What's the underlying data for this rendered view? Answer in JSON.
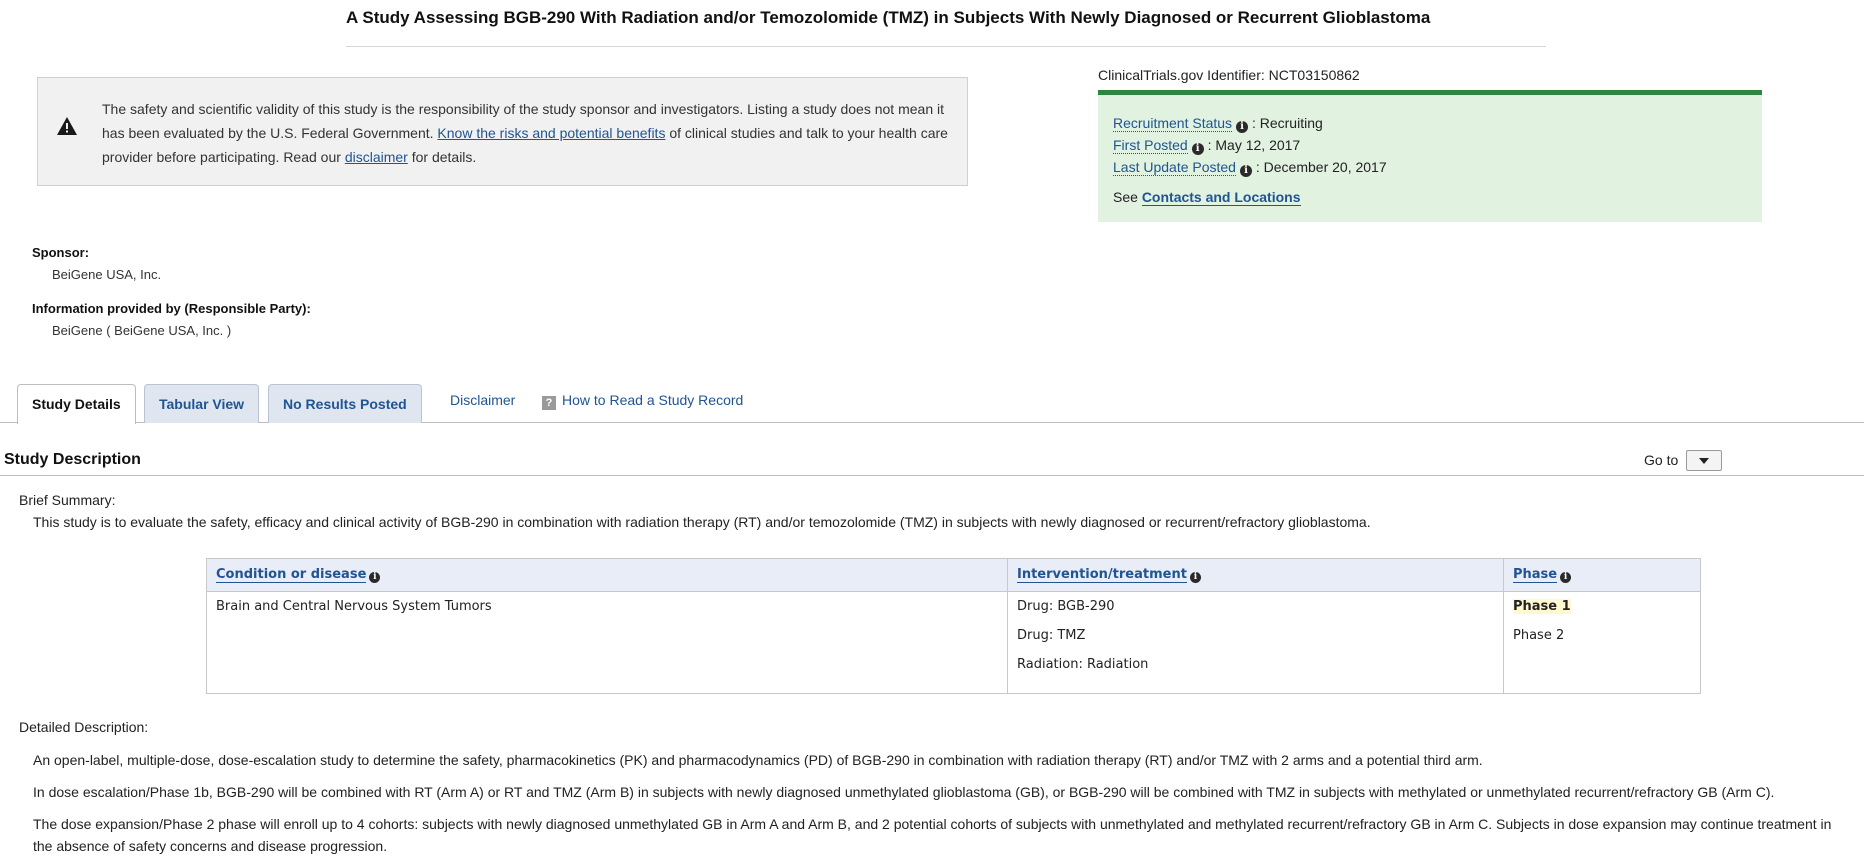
{
  "study": {
    "title": "A Study Assessing BGB-290 With Radiation and/or Temozolomide (TMZ) in Subjects With Newly Diagnosed or Recurrent Glioblastoma"
  },
  "disclaimer": {
    "text_1": "The safety and scientific validity of this study is the responsibility of the study sponsor and investigators. Listing a study does not mean it has been evaluated by the U.S. Federal Government. ",
    "link_risks": "Know the risks and potential benefits",
    "text_2": " of clinical studies and talk to your health care provider before participating. Read our ",
    "link_disclaimer": "disclaimer",
    "text_3": " for details."
  },
  "identifier": {
    "label": "ClinicalTrials.gov Identifier: ",
    "value": "NCT03150862"
  },
  "status": {
    "recruitment_label": "Recruitment Status",
    "recruitment_value": ": Recruiting",
    "first_posted_label": "First Posted",
    "first_posted_value": ": May 12, 2017",
    "last_update_label": "Last Update Posted",
    "last_update_value": ": December 20, 2017",
    "see_prefix": "See ",
    "contacts_link": "Contacts and Locations"
  },
  "sponsor": {
    "label": "Sponsor:",
    "value": "BeiGene USA, Inc."
  },
  "responsible_party": {
    "label": "Information provided by (Responsible Party):",
    "value": "BeiGene ( BeiGene USA, Inc. )"
  },
  "tabs": [
    {
      "label": "Study Details"
    },
    {
      "label": "Tabular View"
    },
    {
      "label": "No Results Posted"
    }
  ],
  "links": {
    "disclaimer": "Disclaimer",
    "how_to_read": "How to Read a Study Record"
  },
  "section": {
    "title": "Study Description",
    "goto_label": "Go to"
  },
  "brief_summary": {
    "label": "Brief Summary:",
    "text": "This study is to evaluate the safety, efficacy and clinical activity of BGB-290 in combination with radiation therapy (RT) and/or temozolomide (TMZ) in subjects with newly diagnosed or recurrent/refractory glioblastoma."
  },
  "conditions_table": {
    "headers": [
      "Condition or disease",
      "Intervention/treatment",
      "Phase"
    ],
    "condition": "Brain and Central Nervous System Tumors",
    "interventions": [
      "Drug: BGB-290",
      "Drug: TMZ",
      "Radiation: Radiation"
    ],
    "phases": [
      "Phase 1",
      "Phase 2"
    ]
  },
  "detailed_description": {
    "label": "Detailed Description:",
    "paragraphs": [
      "An open-label, multiple-dose, dose-escalation study to determine the safety, pharmacokinetics (PK) and pharmacodynamics (PD) of BGB-290 in combination with radiation therapy (RT) and/or TMZ with 2 arms and a potential third arm.",
      "In dose escalation/Phase 1b, BGB-290 will be combined with RT (Arm A) or RT and TMZ (Arm B) in subjects with newly diagnosed unmethylated glioblastoma (GB), or BGB-290 will be combined with TMZ in subjects with methylated or unmethylated recurrent/refractory GB (Arm C).",
      "The dose expansion/Phase 2 phase will enroll up to 4 cohorts: subjects with newly diagnosed unmethylated GB in Arm A and Arm B, and 2 potential cohorts of subjects with unmethylated and methylated recurrent/refractory GB in Arm C. Subjects in dose expansion may continue treatment in the absence of safety concerns and disease progression."
    ]
  }
}
